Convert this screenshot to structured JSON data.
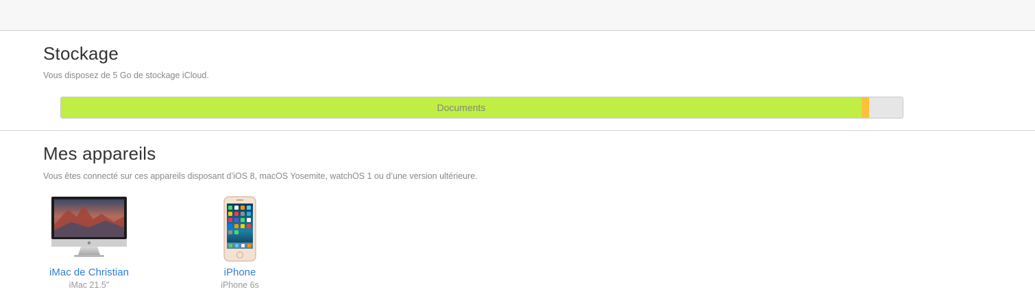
{
  "storage": {
    "title": "Stockage",
    "subtitle": "Vous disposez de 5 Go de stockage iCloud.",
    "bar": {
      "segments": [
        {
          "label": "Documents",
          "fraction": 0.951,
          "color": "#c1ee45"
        },
        {
          "label": "",
          "fraction": 0.009,
          "color": "#fcc13c"
        }
      ],
      "free_color": "#e6e6e6"
    }
  },
  "devices": {
    "title": "Mes appareils",
    "subtitle": "Vous êtes connecté sur ces appareils disposant d’iOS 8, macOS Yosemite, watchOS 1 ou d’une version ultérieure.",
    "items": [
      {
        "name": "iMac de Christian",
        "model": "iMac 21.5\"",
        "icon": "imac-icon"
      },
      {
        "name": "iPhone",
        "model": "iPhone 6s",
        "icon": "iphone-icon"
      }
    ]
  },
  "colors": {
    "link": "#2f7ed8",
    "documents": "#c1ee45",
    "other": "#fcc13c"
  }
}
